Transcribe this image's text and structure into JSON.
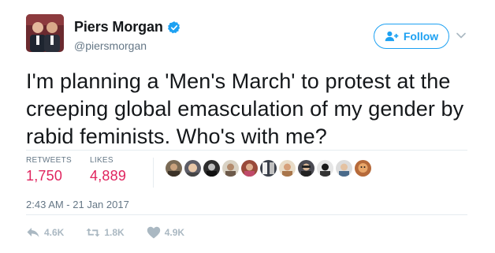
{
  "author": {
    "display_name": "Piers Morgan",
    "handle": "@piersmorgan",
    "verified_icon": "verified-badge-icon"
  },
  "follow_button": {
    "label": "Follow",
    "icon": "add-user-icon"
  },
  "tweet": {
    "text": "I'm planning a 'Men's March' to protest at the creeping global emasculation of my gender by rabid feminists. Who's with me?"
  },
  "stats": {
    "retweets_label": "RETWEETS",
    "retweets_value": "1,750",
    "likes_label": "LIKES",
    "likes_value": "4,889"
  },
  "timestamp": "2:43 AM - 21 Jan 2017",
  "actions": {
    "reply_count": "4.6K",
    "retweet_count": "1.8K",
    "like_count": "4.9K"
  },
  "colors": {
    "accent": "#1da1f2",
    "stat_value": "#e0245e",
    "muted": "#657786",
    "action_gray": "#aab8c2"
  }
}
